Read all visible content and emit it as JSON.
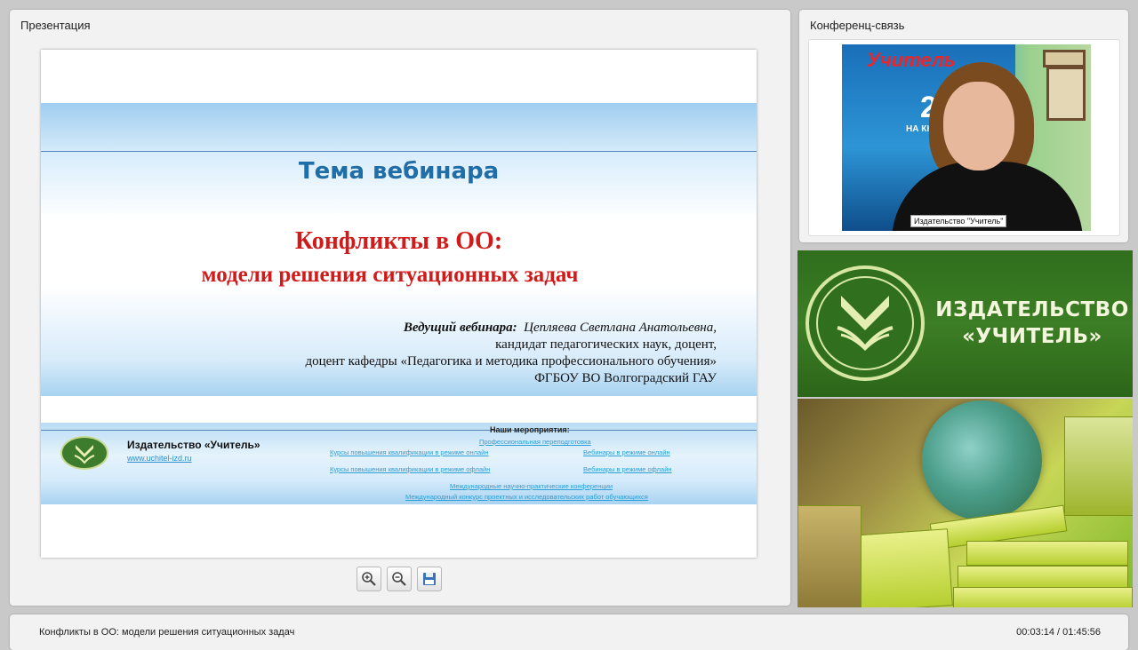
{
  "presentation": {
    "panel_title": "Презентация",
    "slide": {
      "topic": "Тема вебинара",
      "title_line1": "Конфликты в ОО:",
      "title_line2": "модели решения ситуационных задач",
      "speaker_label": "Ведущий вебинара",
      "speaker_name": "Цепляева Светлана Анатольевна,",
      "speaker_line2": "кандидат педагогических наук,  доцент,",
      "speaker_line3": "доцент кафедры «Педагогика и методика профессионального обучения»",
      "speaker_line4": "ФГБОУ ВО Волгоградский ГАУ",
      "publisher": "Издательство «Учитель»",
      "publisher_url": "www.uchitel-izd.ru",
      "events_title": "Наши мероприятия:",
      "events": [
        "Профессиональная переподготовка",
        "Курсы повышения квалификации в режиме онлайн",
        "Вебинары в режиме онлайн",
        "Курсы повышения квалификации в режиме офлайн",
        "Вебинары в режиме офлайн",
        "Международные научно-практические конференции",
        "Международный конкурс проектных и исследовательских работ обучающихся"
      ]
    },
    "toolbar": {
      "zoom_in_icon": "zoom-in-icon",
      "zoom_out_icon": "zoom-out-icon",
      "save_icon": "save-icon"
    }
  },
  "conference": {
    "panel_title": "Конференц-связь",
    "video_caption": "Издательство \"Учитель\"",
    "video_banner_text": "Учитель",
    "video_banner_number": "25",
    "video_banner_sub": "НА КНИЖ"
  },
  "publisher_logo": {
    "line1": "ИЗДАТЕЛЬСТВО",
    "line2": "«УЧИТЕЛЬ»"
  },
  "bottom_bar": {
    "title": "Конфликты в ОО: модели решения ситуационных задач",
    "current_time": "00:03:14",
    "separator": " / ",
    "total_time": "01:45:56"
  },
  "colors": {
    "accent_blue": "#1f6ea7",
    "title_red": "#d11b1b",
    "logo_green": "#3c7e25",
    "link_blue": "#2c9fd6"
  }
}
